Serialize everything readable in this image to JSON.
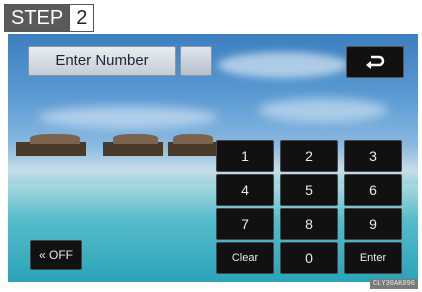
{
  "step": {
    "label": "STEP",
    "number": "2"
  },
  "header": {
    "enter_number_label": "Enter Number",
    "number_value": ""
  },
  "back_button": {
    "icon": "return-arrow-icon"
  },
  "keypad": {
    "k1": "1",
    "k2": "2",
    "k3": "3",
    "k4": "4",
    "k5": "5",
    "k6": "6",
    "k7": "7",
    "k8": "8",
    "k9": "9",
    "clear": "Clear",
    "k0": "0",
    "enter": "Enter"
  },
  "off_button": {
    "label": "OFF",
    "icon": "double-chevron-left-icon"
  },
  "figure_code": "CLY30AK096"
}
